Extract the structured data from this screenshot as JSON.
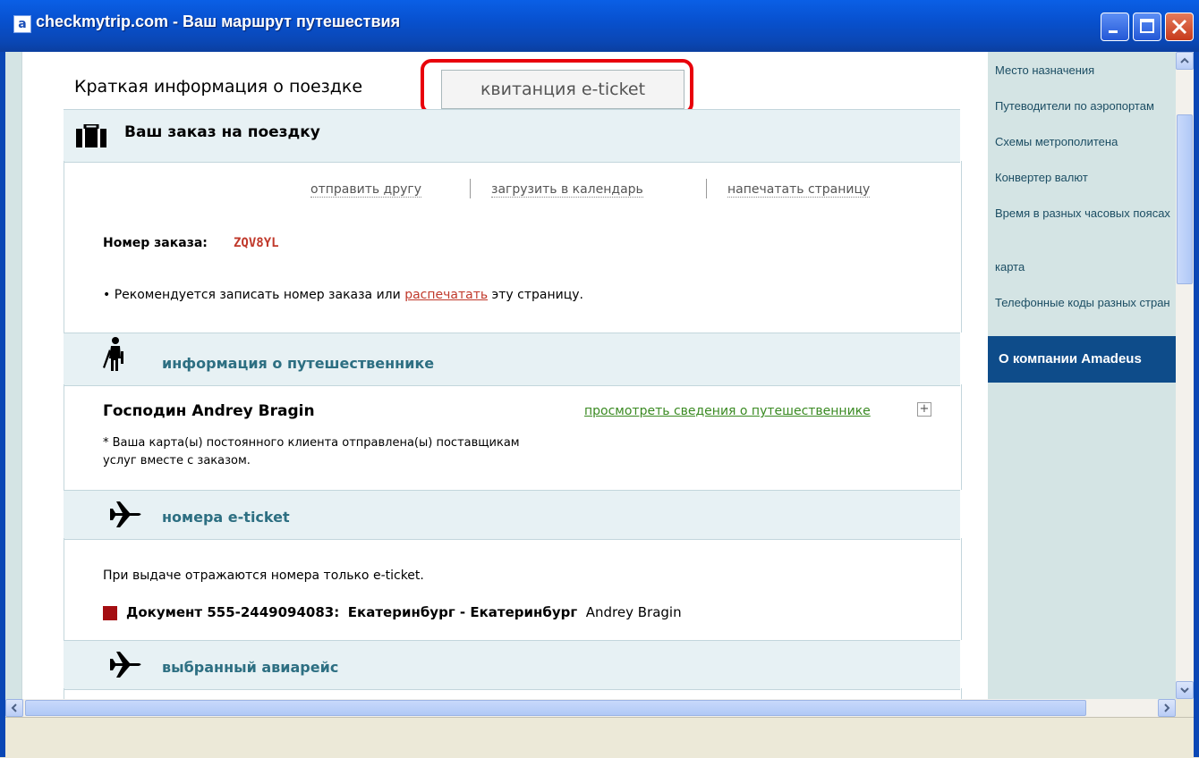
{
  "window": {
    "title": "checkmytrip.com - Ваш маршрут путешествия"
  },
  "tabs": {
    "active_label": "Краткая информация о поездке",
    "inactive_label": "квитанция e-ticket"
  },
  "trip": {
    "heading": "Ваш заказ на поездку",
    "actions": [
      "отправить другу",
      "загрузить в календарь",
      "напечатать страницу"
    ],
    "order_label": "Номер заказа:",
    "order_number": "ZQV8YL",
    "note_before": "• Рекомендуется записать номер заказа или ",
    "note_link": "распечатать",
    "note_after": " эту страницу."
  },
  "traveler": {
    "heading": "информация о путешественнике",
    "name": "Господин Andrey Bragin",
    "details_link": "просмотреть сведения о путешественнике",
    "ff_note": "* Ваша карта(ы) постоянного клиента отправлена(ы) поставщикам услуг вместе с заказом."
  },
  "eticket": {
    "heading": "номера e-ticket",
    "note": "При выдаче отражаются номера только e-ticket.",
    "doc_label": "Документ 555-2449094083:",
    "route": "Екатеринбург - Екатеринбург",
    "passenger": "Andrey Bragin"
  },
  "flight": {
    "heading": "выбранный авиарейс"
  },
  "sidebar": {
    "items": [
      "Место назначения",
      "Путеводители по аэропортам",
      "Схемы метрополитена",
      "Конвертер валют",
      "Время в разных часовых поясах",
      "карта",
      "Телефонные коды разных стран"
    ],
    "company_label": "О компании Amadeus"
  },
  "colors": {
    "accent_red": "#E8000B",
    "order_number": "#C0392B",
    "link_green": "#3A8A22",
    "section_teal": "#2D6F82",
    "company_bar": "#0E4C8A"
  }
}
